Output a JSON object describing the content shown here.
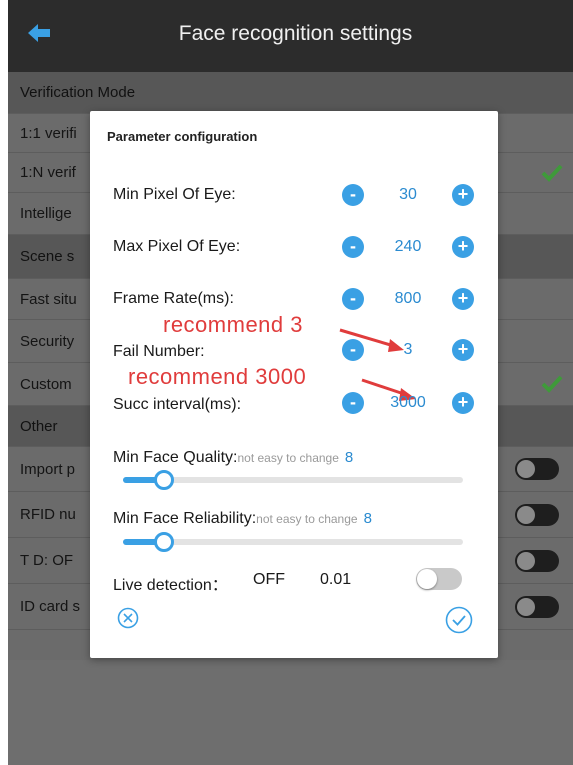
{
  "header": {
    "title": "Face recognition settings"
  },
  "background_rows": [
    {
      "label": "Verification Mode",
      "kind": "section",
      "check": false,
      "toggle": false
    },
    {
      "label": "1:1 verifi",
      "kind": "item",
      "check": false,
      "toggle": false
    },
    {
      "label": "1:N verif",
      "kind": "item",
      "check": true,
      "toggle": false
    },
    {
      "label": "Intellige",
      "kind": "item",
      "check": false,
      "toggle": false
    },
    {
      "label": "Scene s",
      "kind": "section",
      "check": false,
      "toggle": false
    },
    {
      "label": "Fast situ",
      "kind": "item",
      "check": false,
      "toggle": false
    },
    {
      "label": "Security",
      "kind": "item",
      "check": false,
      "toggle": false
    },
    {
      "label": "Custom",
      "kind": "item",
      "check": true,
      "toggle": false
    },
    {
      "label": "Other",
      "kind": "section",
      "check": false,
      "toggle": false
    },
    {
      "label": "Import p",
      "kind": "item",
      "check": false,
      "toggle": true
    },
    {
      "label": "RFID nu",
      "kind": "item",
      "check": false,
      "toggle": true
    },
    {
      "label": "T D: OF",
      "kind": "item",
      "check": false,
      "toggle": true
    },
    {
      "label": "ID card s",
      "kind": "item",
      "check": false,
      "toggle": true
    }
  ],
  "dialog": {
    "title": "Parameter configuration",
    "params": [
      {
        "label": "Min Pixel Of Eye:",
        "value": "30"
      },
      {
        "label": "Max Pixel Of Eye:",
        "value": "240"
      },
      {
        "label": "Frame Rate(ms):",
        "value": "800"
      },
      {
        "label": "Fail Number:",
        "value": "3"
      },
      {
        "label": "Succ interval(ms):",
        "value": "3000"
      }
    ],
    "minus_symbol": "-",
    "plus_symbol": "+",
    "annotations": [
      {
        "text": "recommend 3"
      },
      {
        "text": "recommend 3000"
      }
    ],
    "sliders": [
      {
        "label": "Min Face Quality:",
        "hint": "not easy to change",
        "value": "8",
        "level": 0.12
      },
      {
        "label": "Min Face Reliability:",
        "hint": "not easy to change",
        "value": "8",
        "level": 0.12
      }
    ],
    "live": {
      "label": "Live detection：",
      "state": "OFF",
      "value": "0.01",
      "toggle_on": false
    }
  },
  "colors": {
    "accent": "#3aa0e4",
    "value_text": "#2b8bd0",
    "annotation": "#e03c3c",
    "check": "#3f9a3a"
  }
}
